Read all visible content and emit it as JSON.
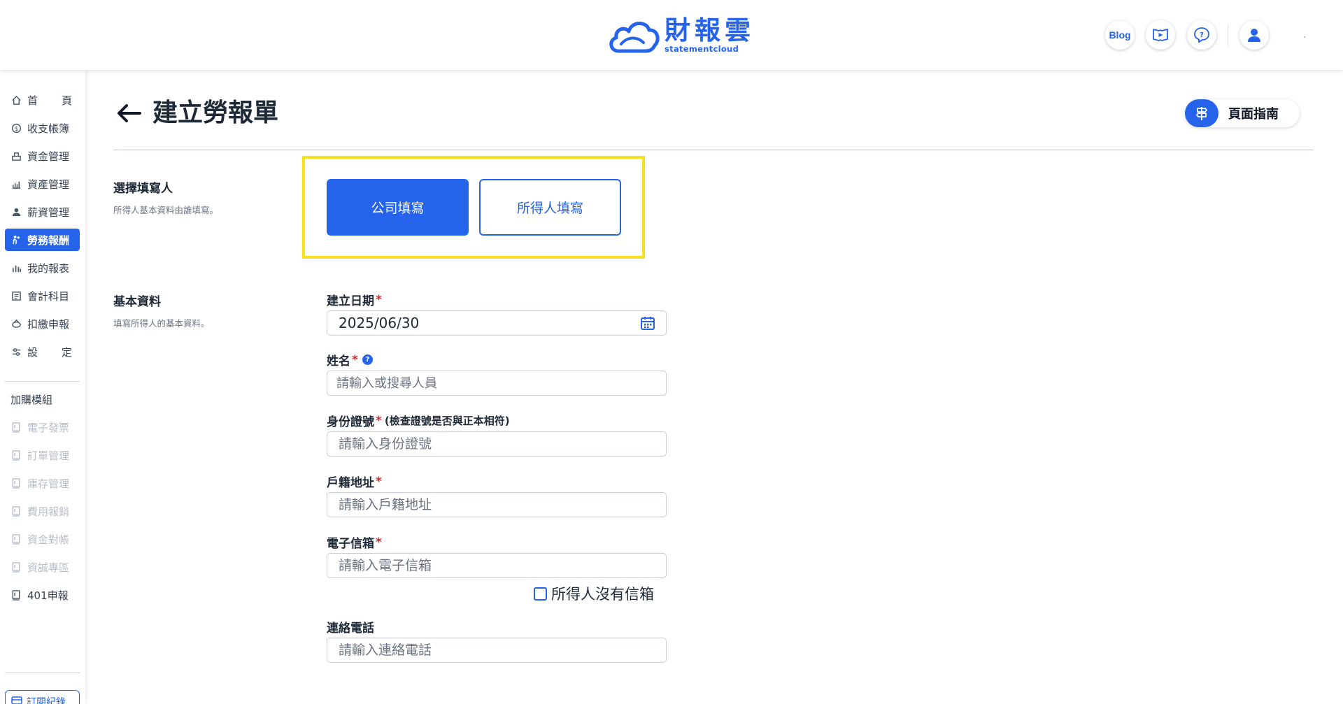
{
  "header": {
    "logo_cn": "財報雲",
    "logo_en": "statementcloud",
    "blog_label": "Blog",
    "icons": [
      "video-icon",
      "help-chat-icon",
      "user-icon"
    ]
  },
  "sidebar": {
    "items": [
      {
        "label": "首",
        "label2": "頁",
        "icon": "home-icon"
      },
      {
        "label": "收支帳簿",
        "icon": "coin-icon"
      },
      {
        "label": "資金管理",
        "icon": "funds-icon"
      },
      {
        "label": "資產管理",
        "icon": "assets-icon"
      },
      {
        "label": "薪資管理",
        "icon": "salary-icon"
      },
      {
        "label": "勞務報酬",
        "icon": "labor-icon",
        "active": true
      },
      {
        "label": "我的報表",
        "icon": "chart-icon"
      },
      {
        "label": "會計科目",
        "icon": "ledger-icon"
      },
      {
        "label": "扣繳申報",
        "icon": "withholding-icon"
      },
      {
        "label": "設",
        "label2": "定",
        "icon": "settings-icon"
      }
    ],
    "addon_title": "加購模組",
    "addons": [
      {
        "label": "電子發票",
        "icon": "module-icon"
      },
      {
        "label": "訂單管理",
        "icon": "module-icon"
      },
      {
        "label": "庫存管理",
        "icon": "module-icon"
      },
      {
        "label": "費用報銷",
        "icon": "module-icon"
      },
      {
        "label": "資金對帳",
        "icon": "module-icon"
      },
      {
        "label": "資誠專區",
        "icon": "module-icon"
      },
      {
        "label": "401申報",
        "icon": "module-icon",
        "enabled": true
      }
    ],
    "subscription_label": "訂閱紀錄"
  },
  "page": {
    "title": "建立勞報單",
    "guide_label": "頁面指南"
  },
  "sections": {
    "filler": {
      "title": "選擇填寫人",
      "desc": "所得人基本資料由誰填寫。",
      "company_btn": "公司填寫",
      "payee_btn": "所得人填寫",
      "selected": "company"
    },
    "basic": {
      "title": "基本資料",
      "desc": "填寫所得人的基本資料。"
    }
  },
  "form": {
    "date": {
      "label": "建立日期",
      "required": "*",
      "value": "2025/06/30"
    },
    "name": {
      "label": "姓名",
      "required": "*",
      "help": "?",
      "placeholder": "請輸入或搜尋人員"
    },
    "id_number": {
      "label": "身份證號",
      "required": "*",
      "note": "(檢查證號是否與正本相符)",
      "placeholder": "請輸入身份證號"
    },
    "address": {
      "label": "戶籍地址",
      "required": "*",
      "placeholder": "請輸入戶籍地址"
    },
    "email": {
      "label": "電子信箱",
      "required": "*",
      "placeholder": "請輸入電子信箱",
      "no_email_label": "所得人沒有信箱",
      "no_email_checked": false
    },
    "phone": {
      "label": "連絡電話",
      "placeholder": "請輸入連絡電話"
    }
  },
  "colors": {
    "accent": "#2563eb",
    "highlight": "#f7e01e",
    "required": "#dc2626"
  }
}
